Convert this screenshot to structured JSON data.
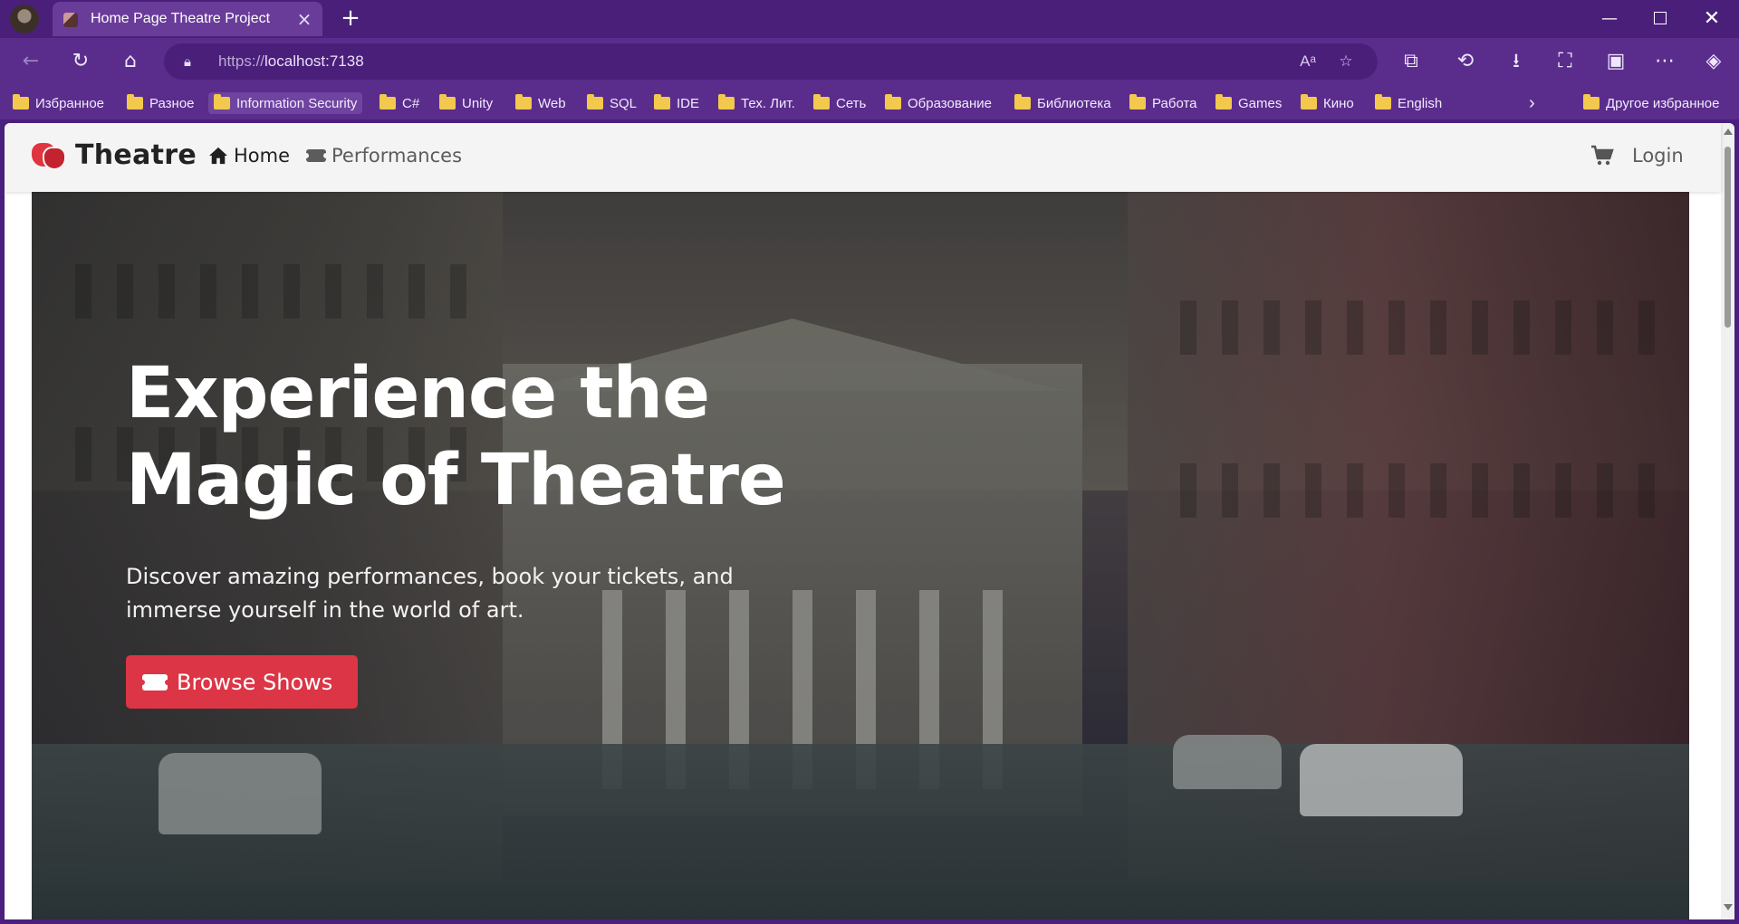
{
  "browser": {
    "tab_title": "Home Page Theatre Project",
    "url_scheme": "https://",
    "url_host": "localhost:7138",
    "bookmarks": [
      {
        "label": "Избранное"
      },
      {
        "label": "Разное"
      },
      {
        "label": "Information Security"
      },
      {
        "label": "C#"
      },
      {
        "label": "Unity"
      },
      {
        "label": "Web"
      },
      {
        "label": "SQL"
      },
      {
        "label": "IDE"
      },
      {
        "label": "Тех. Лит."
      },
      {
        "label": "Сеть"
      },
      {
        "label": "Образование"
      },
      {
        "label": "Библиотека"
      },
      {
        "label": "Работа"
      },
      {
        "label": "Games"
      },
      {
        "label": "Кино"
      },
      {
        "label": "English"
      }
    ],
    "other_favorites": "Другое избранное"
  },
  "site": {
    "brand": "Theatre",
    "nav": {
      "home": "Home",
      "performances": "Performances",
      "login": "Login"
    }
  },
  "hero": {
    "title_line1": "Experience the",
    "title_line2": "Magic of Theatre",
    "subtitle": "Discover amazing performances, book your tickets, and immerse yourself in the world of art.",
    "cta": "Browse Shows"
  },
  "colors": {
    "chrome": "#5a2d8c",
    "accent": "#dc3545"
  }
}
